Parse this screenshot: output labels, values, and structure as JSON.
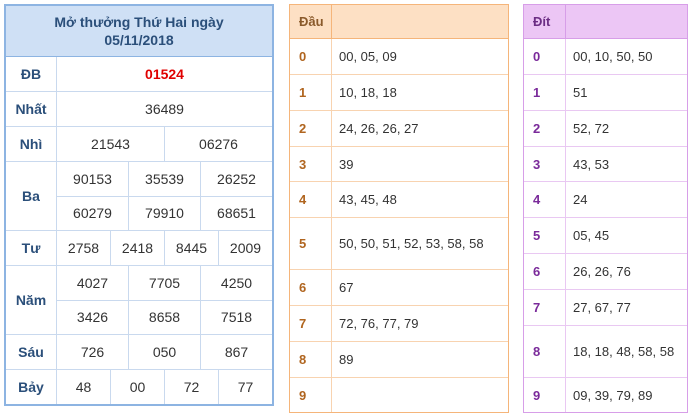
{
  "results": {
    "title_line1": "Mở thưởng Thứ Hai ngày",
    "title_line2": "05/11/2018",
    "prizes": [
      {
        "label": "ĐB",
        "lines": [
          [
            "01524"
          ]
        ],
        "highlight": true
      },
      {
        "label": "Nhất",
        "lines": [
          [
            "36489"
          ]
        ]
      },
      {
        "label": "Nhì",
        "lines": [
          [
            "21543",
            "06276"
          ]
        ]
      },
      {
        "label": "Ba",
        "lines": [
          [
            "90153",
            "35539",
            "26252"
          ],
          [
            "60279",
            "79910",
            "68651"
          ]
        ]
      },
      {
        "label": "Tư",
        "lines": [
          [
            "2758",
            "2418",
            "8445",
            "2009"
          ]
        ]
      },
      {
        "label": "Năm",
        "lines": [
          [
            "4027",
            "7705",
            "4250"
          ],
          [
            "3426",
            "8658",
            "7518"
          ]
        ]
      },
      {
        "label": "Sáu",
        "lines": [
          [
            "726",
            "050",
            "867"
          ]
        ]
      },
      {
        "label": "Bảy",
        "lines": [
          [
            "48",
            "00",
            "72",
            "77"
          ]
        ]
      }
    ]
  },
  "dau": {
    "header": "Đầu",
    "rows": [
      {
        "key": "0",
        "value": "00, 05, 09"
      },
      {
        "key": "1",
        "value": "10, 18, 18"
      },
      {
        "key": "2",
        "value": "24, 26, 26, 27"
      },
      {
        "key": "3",
        "value": "39"
      },
      {
        "key": "4",
        "value": "43, 45, 48"
      },
      {
        "key": "5",
        "value": "50, 50, 51, 52, 53, 58, 58"
      },
      {
        "key": "6",
        "value": "67"
      },
      {
        "key": "7",
        "value": "72, 76, 77, 79"
      },
      {
        "key": "8",
        "value": "89"
      },
      {
        "key": "9",
        "value": ""
      }
    ]
  },
  "dit": {
    "header": "Đít",
    "rows": [
      {
        "key": "0",
        "value": "00, 10, 50, 50"
      },
      {
        "key": "1",
        "value": "51"
      },
      {
        "key": "2",
        "value": "52, 72"
      },
      {
        "key": "3",
        "value": "43, 53"
      },
      {
        "key": "4",
        "value": "24"
      },
      {
        "key": "5",
        "value": "05, 45"
      },
      {
        "key": "6",
        "value": "26, 26, 76"
      },
      {
        "key": "7",
        "value": "27, 67, 77"
      },
      {
        "key": "8",
        "value": "18, 18, 48, 58, 58"
      },
      {
        "key": "9",
        "value": "09, 39, 79, 89"
      }
    ]
  },
  "colors": {
    "special_prize": "#e00000",
    "results_header_bg": "#cfe0f5",
    "dau_header_bg": "#fde0c4",
    "dit_header_bg": "#ecc6f5"
  }
}
